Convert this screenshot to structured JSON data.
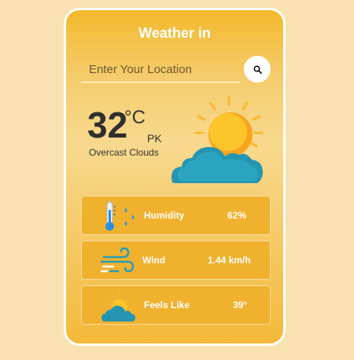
{
  "app": {
    "title": "Weather in"
  },
  "search": {
    "placeholder": "Enter Your Location",
    "icon": "search-icon"
  },
  "current": {
    "temperature": "32",
    "unit": "°C",
    "country": "PK",
    "condition": "Overcast Clouds",
    "icon": "sun-behind-cloud-icon"
  },
  "details": [
    {
      "label": "Humidity",
      "value": "62%",
      "icon": "thermometer-raindrops-icon"
    },
    {
      "label": "Wind",
      "value": "1.44 km/h",
      "icon": "wind-icon"
    },
    {
      "label": "Feels Like",
      "value": "39°",
      "icon": "sun-cloud-icon"
    }
  ],
  "colors": {
    "background": "#f9e2b0",
    "card_top": "#f3b92c",
    "tile": "#f0b12e",
    "cloud": "#2a9cb8",
    "sun": "#fbc02d"
  }
}
